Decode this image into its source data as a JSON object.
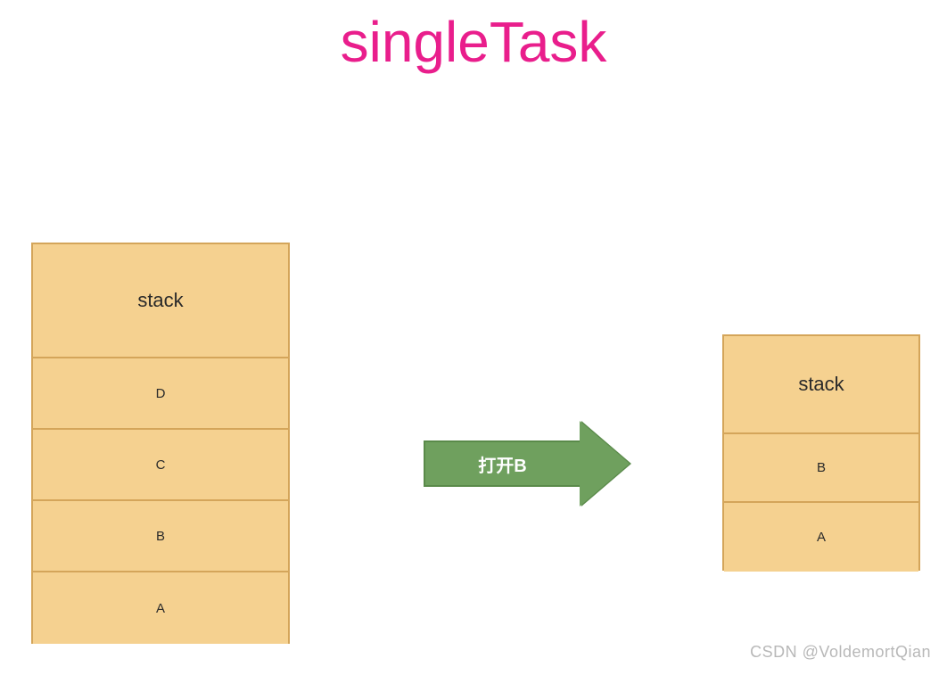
{
  "title": "singleTask",
  "leftStack": {
    "header": "stack",
    "items": [
      "D",
      "C",
      "B",
      "A"
    ]
  },
  "arrow": {
    "label": "打开B"
  },
  "rightStack": {
    "header": "stack",
    "items": [
      "B",
      "A"
    ]
  },
  "watermark": "CSDN @VoldemortQian"
}
